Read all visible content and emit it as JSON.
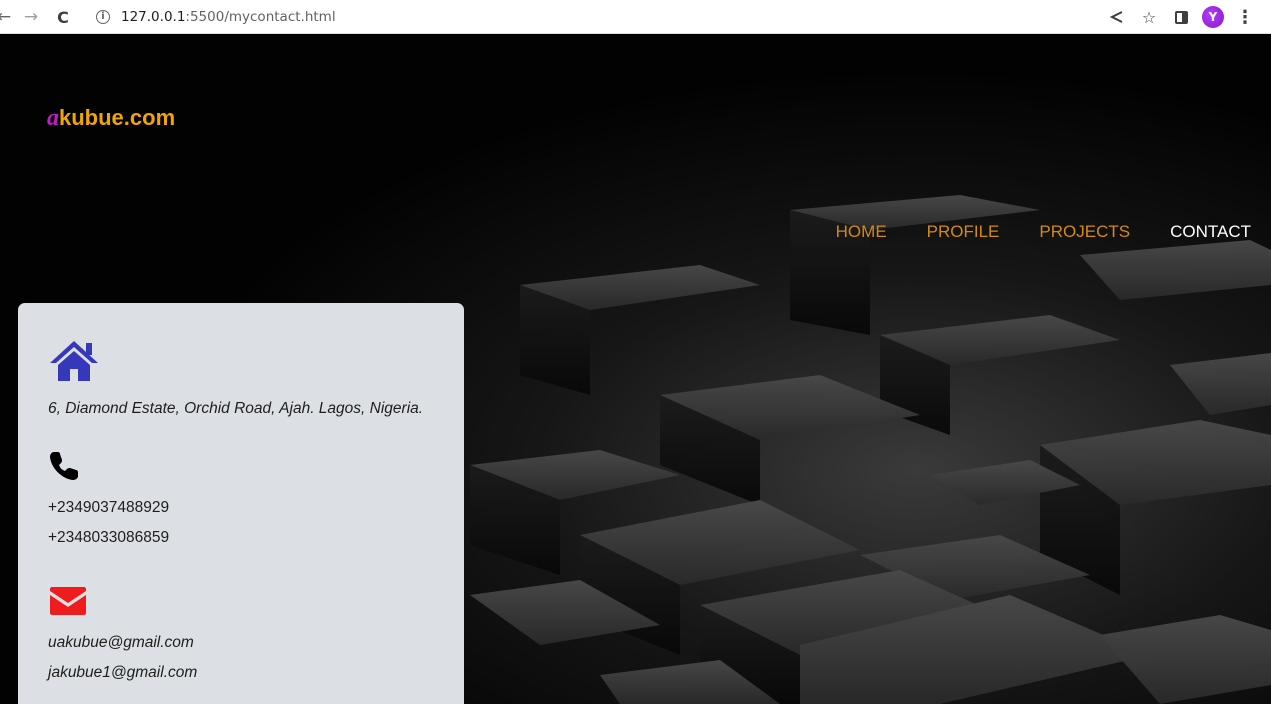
{
  "browser": {
    "url_host": "127.0.0.1",
    "url_rest": ":5500/mycontact.html",
    "avatar_letter": "Y",
    "icons": [
      "back-arrow-icon",
      "forward-arrow-icon",
      "reload-icon",
      "info-icon",
      "share-icon",
      "bookmark-star-icon",
      "side-panel-icon",
      "profile-avatar",
      "kebab-menu-icon"
    ]
  },
  "site": {
    "logo_first": "a",
    "logo_rest": "kubue.com",
    "logo_color": "#f0a500",
    "logo_accent": "#c01cc5"
  },
  "nav": {
    "items": [
      {
        "label": "HOME"
      },
      {
        "label": "PROFILE"
      },
      {
        "label": "PROJECTS"
      },
      {
        "label": "CONTACT",
        "active": true
      }
    ],
    "color": "#d48a16",
    "active_color": "#ffffff"
  },
  "contact": {
    "address": "6, Diamond Estate, Orchid Road, Ajah. Lagos, Nigeria.",
    "phones": [
      "+2349037488929",
      "+2348033086859"
    ],
    "emails": [
      "uakubue@gmail.com",
      "jakubue1@gmail.com"
    ],
    "icons": {
      "home": "#3538b8",
      "phone": "#000000",
      "email": "#ee1c1c"
    }
  }
}
